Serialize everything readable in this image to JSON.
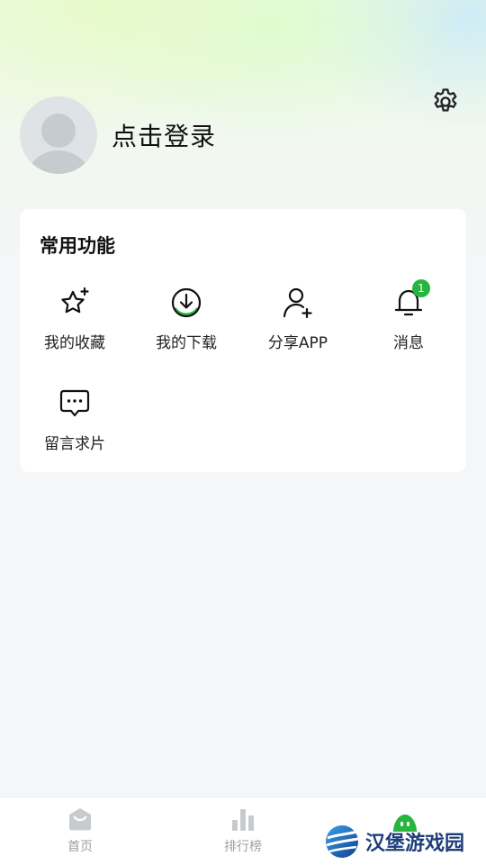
{
  "header": {
    "login_text": "点击登录",
    "settings_icon": "gear-icon"
  },
  "functions": {
    "title": "常用功能",
    "items": [
      {
        "label": "我的收藏",
        "icon": "star-sparkle-icon"
      },
      {
        "label": "我的下载",
        "icon": "download-icon"
      },
      {
        "label": "分享APP",
        "icon": "user-add-icon"
      },
      {
        "label": "消息",
        "icon": "bell-icon",
        "badge": "1"
      },
      {
        "label": "留言求片",
        "icon": "chat-bubble-icon"
      }
    ]
  },
  "tabbar": {
    "items": [
      {
        "label": "首页",
        "icon": "home-icon"
      },
      {
        "label": "排行榜",
        "icon": "bar-chart-icon"
      },
      {
        "label": "",
        "icon": "mine-icon",
        "active": true
      }
    ]
  },
  "watermark": {
    "text": "汉堡游戏园"
  },
  "colors": {
    "accent": "#27b53f",
    "background": "#f4f6f8",
    "tab_inactive": "#9aa0a6"
  }
}
